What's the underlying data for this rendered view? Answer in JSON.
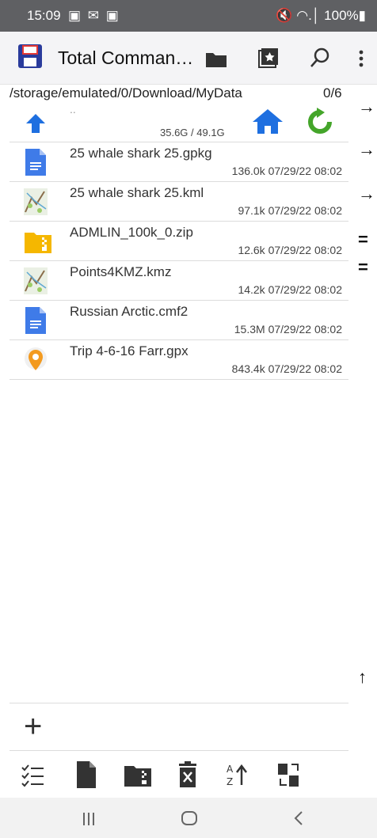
{
  "status_bar": {
    "time": "15:09",
    "left_icons": "▣ ✉ ▣",
    "right": "🔇 ◠.│ 100%▮"
  },
  "app": {
    "title": "Total Comman…"
  },
  "panel": {
    "path": "/storage/emulated/0/Download/MyData",
    "count": "0/6",
    "up": {
      "label": "..",
      "space": "35.6G / 49.1G"
    },
    "files": [
      {
        "name": "25 whale shark 25.gpkg",
        "meta": "136.0k 07/29/22 08:02",
        "icon": "document-icon"
      },
      {
        "name": "25 whale shark 25.kml",
        "meta": "97.1k 07/29/22 08:02",
        "icon": "map-thumbnail-icon"
      },
      {
        "name": "ADMLIN_100k_0.zip",
        "meta": "12.6k 07/29/22 08:02",
        "icon": "zip-folder-icon"
      },
      {
        "name": "Points4KMZ.kmz",
        "meta": "14.2k 07/29/22 08:02",
        "icon": "map-thumbnail-icon"
      },
      {
        "name": "Russian Arctic.cmf2",
        "meta": "15.3M 07/29/22 08:02",
        "icon": "document-icon"
      },
      {
        "name": "Trip 4-6-16 Farr.gpx",
        "meta": "843.4k 07/29/22 08:02",
        "icon": "map-pin-icon"
      }
    ]
  },
  "side_arrows": [
    "→",
    "→",
    "→",
    "=",
    "=",
    "↑"
  ],
  "add_symbol": "+",
  "colors": {
    "status_bar": "#5f6063",
    "accent_blue": "#1e6fe0",
    "refresh_green": "#44a52a",
    "zip_yellow": "#f5b700"
  }
}
